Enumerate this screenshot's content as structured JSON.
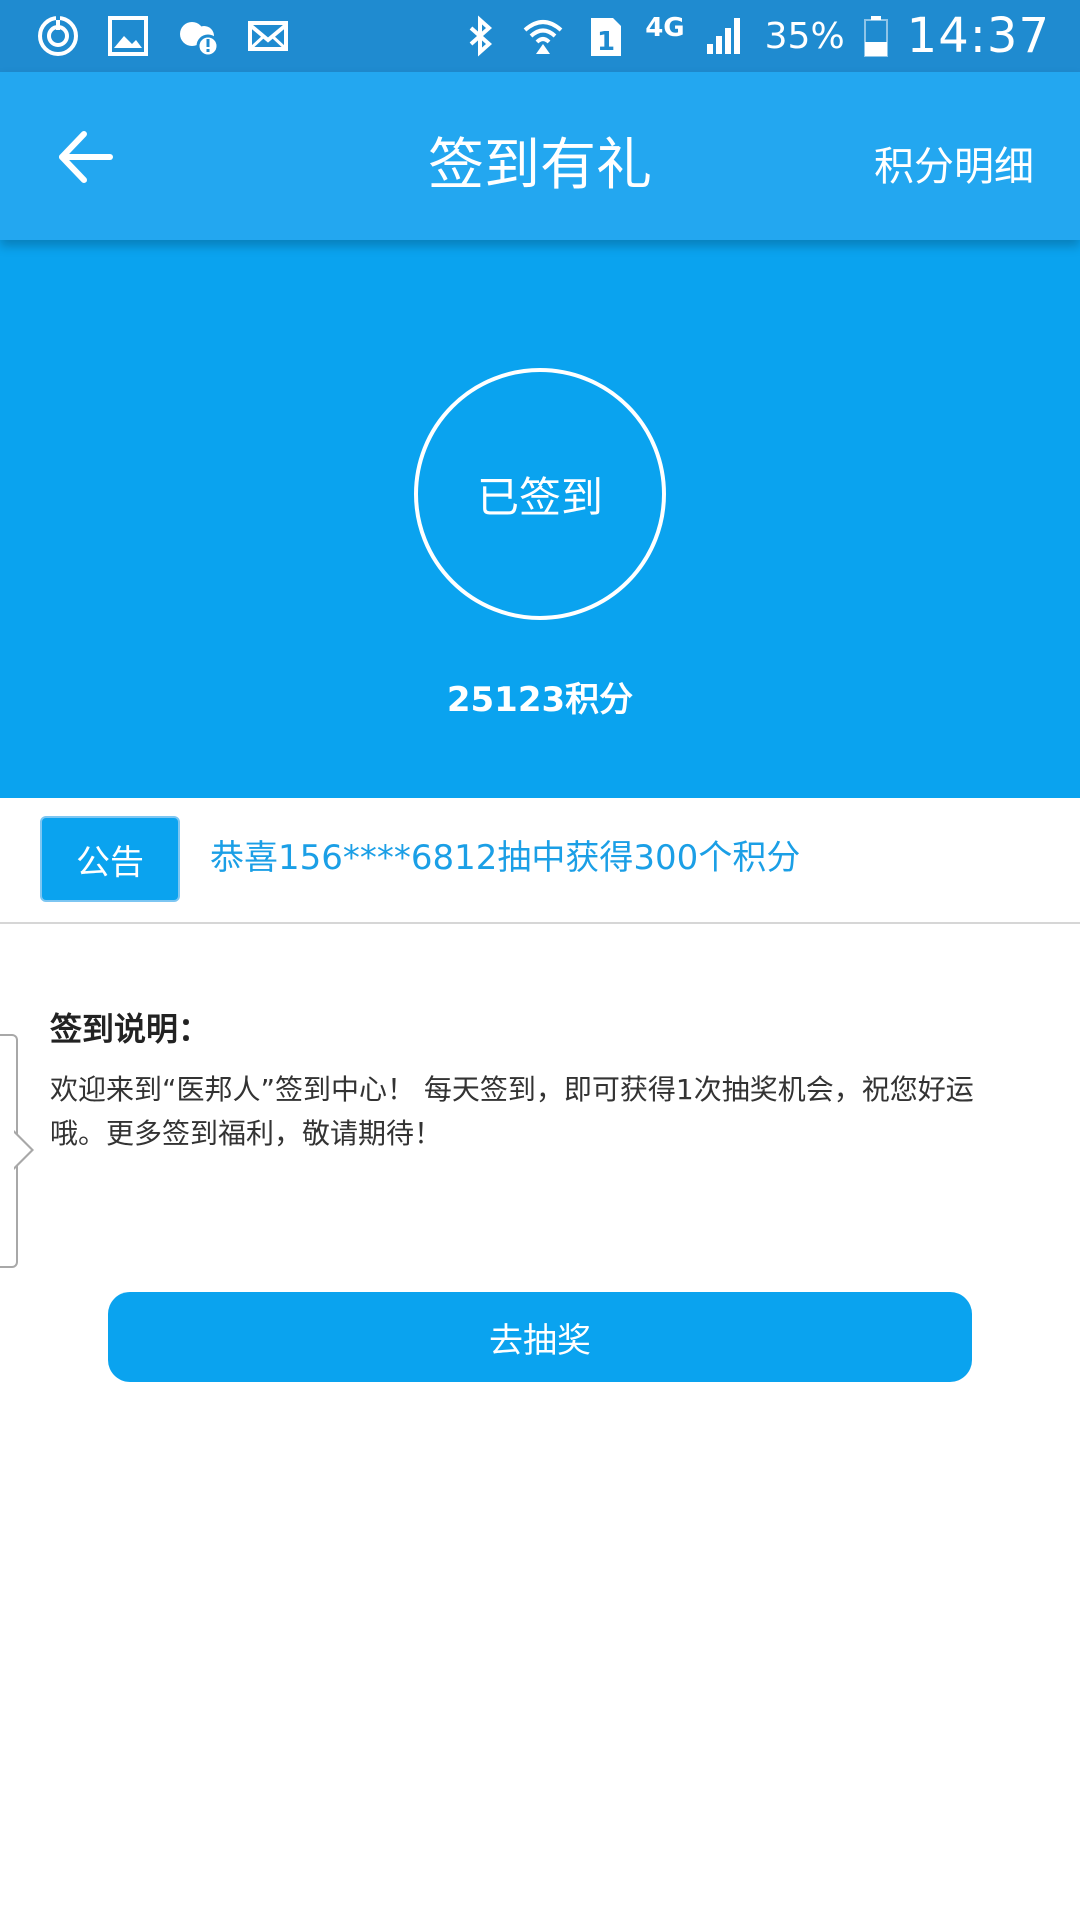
{
  "status_bar": {
    "icons_left": [
      "sync-icon",
      "image-icon",
      "cloud-alert-icon",
      "mail-icon"
    ],
    "icons_right": [
      "bluetooth-icon",
      "wifi-icon",
      "sim-1-icon",
      "signal-icon",
      "battery-icon"
    ],
    "network": "4G",
    "battery": "35%",
    "time": "14:37"
  },
  "app_bar": {
    "title": "签到有礼",
    "action": "积分明细",
    "back_icon": "arrow-left-icon"
  },
  "hero": {
    "status": "已签到",
    "points": "25123积分"
  },
  "notice": {
    "badge": "公告",
    "text": "恭喜156****6812抽中获得300个积分"
  },
  "instructions": {
    "title": "签到说明：",
    "body": "欢迎来到“医邦人”签到中心！ 每天签到，即可获得1次抽奖机会，祝您好运哦。更多签到福利，敬请期待！"
  },
  "actions": {
    "lottery": "去抽奖"
  },
  "colors": {
    "status_bar": "#1f8bd0",
    "app_bar": "#23a7f0",
    "primary": "#0aa3ef",
    "notice_text": "#1b9fe6"
  }
}
